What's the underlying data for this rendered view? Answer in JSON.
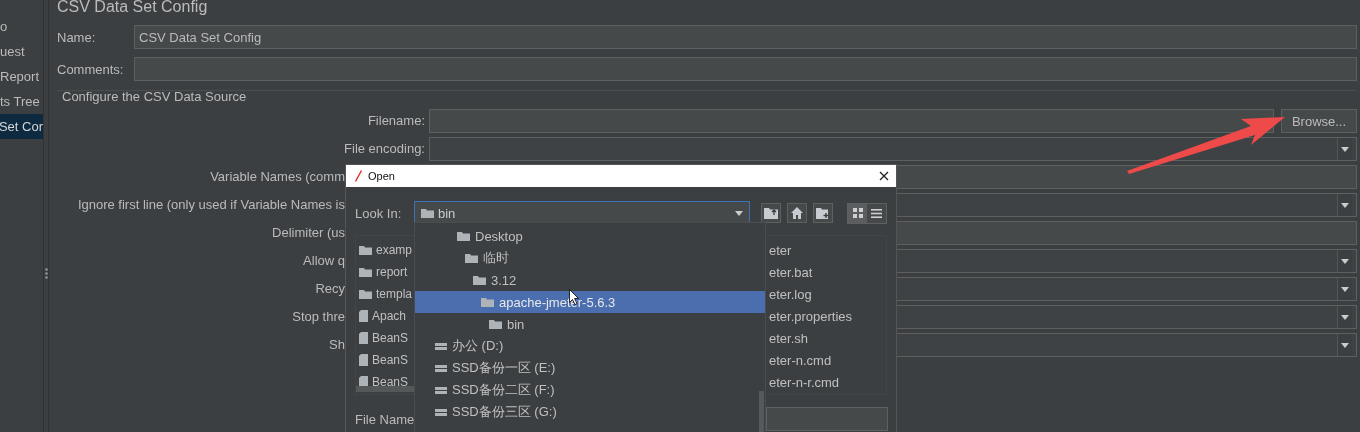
{
  "sidebar": {
    "items": [
      {
        "label": "o",
        "selected": false
      },
      {
        "label": "uest",
        "selected": false
      },
      {
        "label": "Report",
        "selected": false
      },
      {
        "label": "ts Tree",
        "selected": false
      },
      {
        "label": "Set Cor",
        "selected": true
      }
    ]
  },
  "panel": {
    "title": "CSV Data Set Config",
    "name": {
      "label": "Name:",
      "value": "CSV Data Set Config"
    },
    "comments": {
      "label": "Comments:"
    },
    "group_title": "Configure the CSV Data Source",
    "rows": [
      {
        "label": "Filename:",
        "kind": "text",
        "button": "Browse..."
      },
      {
        "label": "File encoding:",
        "kind": "combo"
      },
      {
        "label": "Variable Names (comm",
        "kind": "text"
      },
      {
        "label": "Ignore first line (only used if Variable Names is",
        "kind": "combo"
      },
      {
        "label": "Delimiter (us",
        "kind": "text"
      },
      {
        "label": "Allow q",
        "kind": "combo"
      },
      {
        "label": "Recy",
        "kind": "combo"
      },
      {
        "label": "Stop thre",
        "kind": "combo"
      },
      {
        "label": "Sh",
        "kind": "combo"
      }
    ]
  },
  "dialog": {
    "title": "Open",
    "look_in": {
      "label": "Look In:",
      "value": "bin"
    },
    "view_modes": [
      {
        "kind": "list",
        "selected": true
      },
      {
        "kind": "details",
        "selected": false
      }
    ],
    "files_left": [
      {
        "name": "examp",
        "kind": "folder"
      },
      {
        "name": "report",
        "kind": "folder"
      },
      {
        "name": "templa",
        "kind": "folder"
      },
      {
        "name": "Apach",
        "kind": "file"
      },
      {
        "name": "BeanS",
        "kind": "file"
      },
      {
        "name": "BeanS",
        "kind": "file"
      },
      {
        "name": "BeanS",
        "kind": "file"
      }
    ],
    "files_right": [
      "eter",
      "eter.bat",
      "eter.log",
      "eter.properties",
      "eter.sh",
      "eter-n.cmd",
      "eter-n-r.cmd"
    ],
    "file_name_label": "File Name",
    "dropdown": {
      "items": [
        {
          "label": "Desktop",
          "kind": "folder",
          "selected": false,
          "children": [
            {
              "label": "临时",
              "kind": "folder",
              "selected": false,
              "children": [
                {
                  "label": "3.12",
                  "kind": "folder",
                  "selected": false,
                  "children": [
                    {
                      "label": "apache-jmeter-5.6.3",
                      "kind": "folder",
                      "selected": true,
                      "children": [
                        {
                          "label": "bin",
                          "kind": "folder",
                          "selected": false
                        }
                      ]
                    }
                  ]
                }
              ]
            }
          ]
        },
        {
          "label": "办公 (D:)",
          "kind": "drive",
          "selected": false
        },
        {
          "label": "SSD备份一区 (E:)",
          "kind": "drive",
          "selected": false
        },
        {
          "label": "SSD备份二区 (F:)",
          "kind": "drive",
          "selected": false
        },
        {
          "label": "SSD备份三区 (G:)",
          "kind": "drive",
          "selected": false
        }
      ]
    }
  }
}
